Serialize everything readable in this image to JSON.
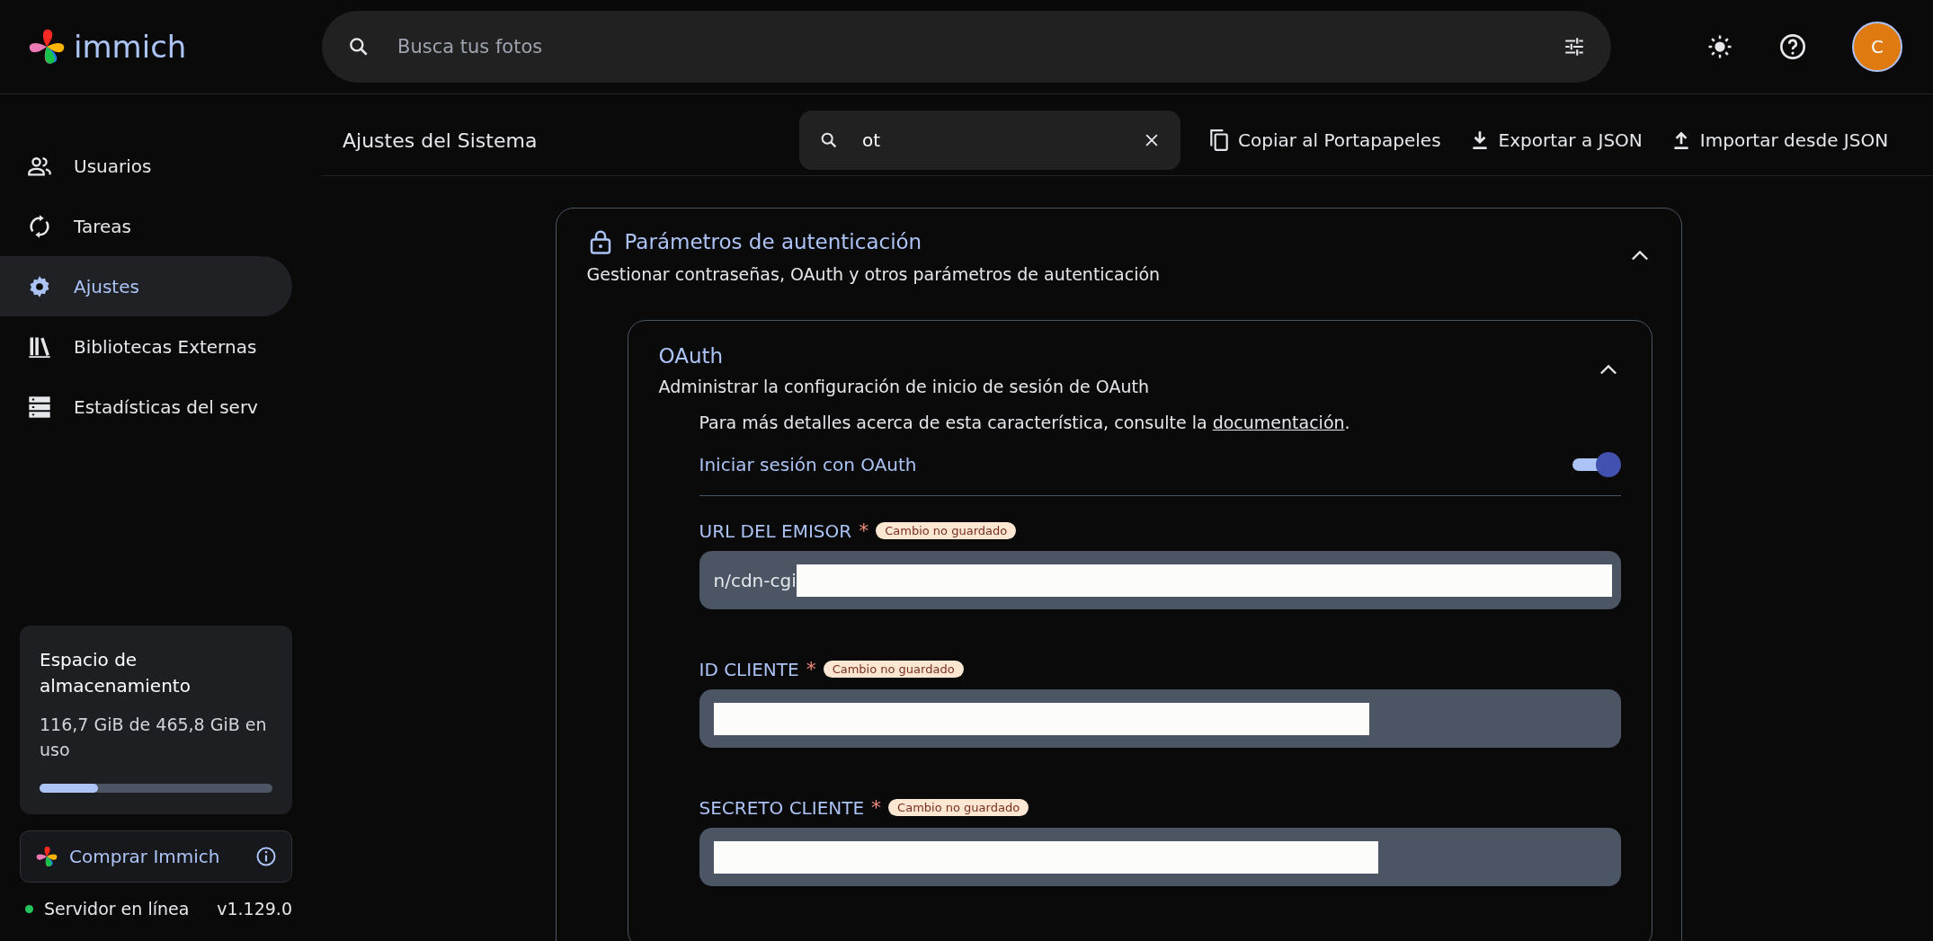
{
  "app": {
    "name": "immich"
  },
  "search": {
    "placeholder": "Busca tus fotos"
  },
  "user": {
    "initial": "C"
  },
  "sidebar": {
    "items": [
      {
        "label": "Usuarios",
        "selected": false
      },
      {
        "label": "Tareas",
        "selected": false
      },
      {
        "label": "Ajustes",
        "selected": true
      },
      {
        "label": "Bibliotecas Externas",
        "selected": false
      },
      {
        "label": "Estadísticas del serv",
        "selected": false
      }
    ]
  },
  "storage": {
    "title": "Espacio de almacenamiento",
    "usage": "116,7 GiB de 465,8 GiB en uso",
    "level": 0.25
  },
  "purchase": {
    "label": "Comprar Immich"
  },
  "server": {
    "status": "Servidor en línea",
    "online": true,
    "version": "v1.129.0"
  },
  "header": {
    "title": "Ajustes del Sistema",
    "filter": {
      "value": "ot"
    },
    "actions": [
      {
        "label": "Copiar al Portapapeles"
      },
      {
        "label": "Exportar a JSON"
      },
      {
        "label": "Importar desde JSON"
      }
    ]
  },
  "section": {
    "title": "Parámetros de autenticación",
    "subtitle": "Gestionar contraseñas, OAuth y otros parámetros de autenticación",
    "expanded": true,
    "subsection": {
      "title": "OAuth",
      "subtitle": "Administrar la configuración de inicio de sesión de OAuth",
      "expanded": true,
      "note": "Para más detalles acerca de esta característica, consulte la ",
      "link": "documentación",
      "note_end": ".",
      "toggle": {
        "label": "Iniciar sesión con OAuth",
        "on": true
      },
      "fields": [
        {
          "label": "URL DEL EMISOR",
          "required_mark": "*",
          "badge": "Cambio no guardado",
          "value": "n/cdn-cgi"
        },
        {
          "label": "ID CLIENTE",
          "required_mark": "*",
          "badge": "Cambio no guardado"
        },
        {
          "label": "SECRETO CLIENTE",
          "required_mark": "*",
          "badge": "Cambio no guardado"
        }
      ]
    }
  }
}
